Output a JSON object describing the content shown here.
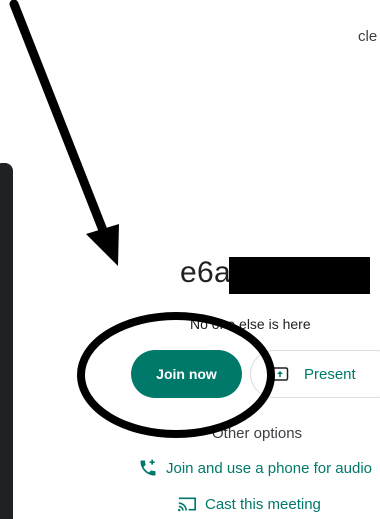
{
  "top_right_partial_text": "cle",
  "meeting": {
    "code_prefix": "e6a",
    "status": "No one else is here"
  },
  "actions": {
    "join_label": "Join now",
    "present_label": "Present"
  },
  "options": {
    "heading": "Other options",
    "phone_audio_label": "Join and use a phone for audio",
    "cast_label": "Cast this meeting"
  },
  "icons": {
    "present": "present-to-all-icon",
    "phone": "phone-add-icon",
    "cast": "cast-icon"
  },
  "colors": {
    "accent": "#00796b",
    "annotation": "#000000",
    "text": "#202124"
  }
}
